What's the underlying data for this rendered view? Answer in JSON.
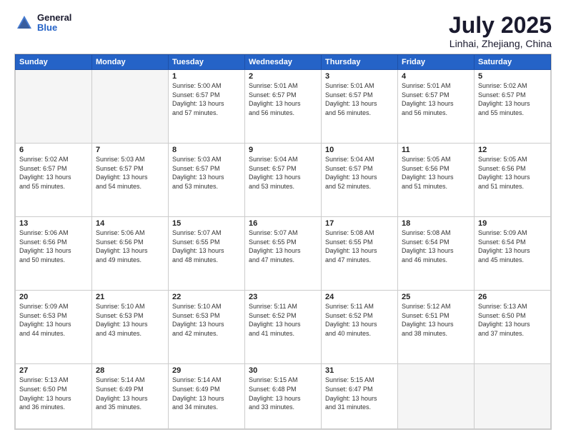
{
  "header": {
    "logo_general": "General",
    "logo_blue": "Blue",
    "title": "July 2025",
    "location": "Linhai, Zhejiang, China"
  },
  "weekdays": [
    "Sunday",
    "Monday",
    "Tuesday",
    "Wednesday",
    "Thursday",
    "Friday",
    "Saturday"
  ],
  "weeks": [
    [
      {
        "day": "",
        "empty": true
      },
      {
        "day": "",
        "empty": true
      },
      {
        "day": "1",
        "sunrise": "5:00 AM",
        "sunset": "6:57 PM",
        "daylight": "13 hours and 57 minutes."
      },
      {
        "day": "2",
        "sunrise": "5:01 AM",
        "sunset": "6:57 PM",
        "daylight": "13 hours and 56 minutes."
      },
      {
        "day": "3",
        "sunrise": "5:01 AM",
        "sunset": "6:57 PM",
        "daylight": "13 hours and 56 minutes."
      },
      {
        "day": "4",
        "sunrise": "5:01 AM",
        "sunset": "6:57 PM",
        "daylight": "13 hours and 56 minutes."
      },
      {
        "day": "5",
        "sunrise": "5:02 AM",
        "sunset": "6:57 PM",
        "daylight": "13 hours and 55 minutes."
      }
    ],
    [
      {
        "day": "6",
        "sunrise": "5:02 AM",
        "sunset": "6:57 PM",
        "daylight": "13 hours and 55 minutes."
      },
      {
        "day": "7",
        "sunrise": "5:03 AM",
        "sunset": "6:57 PM",
        "daylight": "13 hours and 54 minutes."
      },
      {
        "day": "8",
        "sunrise": "5:03 AM",
        "sunset": "6:57 PM",
        "daylight": "13 hours and 53 minutes."
      },
      {
        "day": "9",
        "sunrise": "5:04 AM",
        "sunset": "6:57 PM",
        "daylight": "13 hours and 53 minutes."
      },
      {
        "day": "10",
        "sunrise": "5:04 AM",
        "sunset": "6:57 PM",
        "daylight": "13 hours and 52 minutes."
      },
      {
        "day": "11",
        "sunrise": "5:05 AM",
        "sunset": "6:56 PM",
        "daylight": "13 hours and 51 minutes."
      },
      {
        "day": "12",
        "sunrise": "5:05 AM",
        "sunset": "6:56 PM",
        "daylight": "13 hours and 51 minutes."
      }
    ],
    [
      {
        "day": "13",
        "sunrise": "5:06 AM",
        "sunset": "6:56 PM",
        "daylight": "13 hours and 50 minutes."
      },
      {
        "day": "14",
        "sunrise": "5:06 AM",
        "sunset": "6:56 PM",
        "daylight": "13 hours and 49 minutes."
      },
      {
        "day": "15",
        "sunrise": "5:07 AM",
        "sunset": "6:55 PM",
        "daylight": "13 hours and 48 minutes."
      },
      {
        "day": "16",
        "sunrise": "5:07 AM",
        "sunset": "6:55 PM",
        "daylight": "13 hours and 47 minutes."
      },
      {
        "day": "17",
        "sunrise": "5:08 AM",
        "sunset": "6:55 PM",
        "daylight": "13 hours and 47 minutes."
      },
      {
        "day": "18",
        "sunrise": "5:08 AM",
        "sunset": "6:54 PM",
        "daylight": "13 hours and 46 minutes."
      },
      {
        "day": "19",
        "sunrise": "5:09 AM",
        "sunset": "6:54 PM",
        "daylight": "13 hours and 45 minutes."
      }
    ],
    [
      {
        "day": "20",
        "sunrise": "5:09 AM",
        "sunset": "6:53 PM",
        "daylight": "13 hours and 44 minutes."
      },
      {
        "day": "21",
        "sunrise": "5:10 AM",
        "sunset": "6:53 PM",
        "daylight": "13 hours and 43 minutes."
      },
      {
        "day": "22",
        "sunrise": "5:10 AM",
        "sunset": "6:53 PM",
        "daylight": "13 hours and 42 minutes."
      },
      {
        "day": "23",
        "sunrise": "5:11 AM",
        "sunset": "6:52 PM",
        "daylight": "13 hours and 41 minutes."
      },
      {
        "day": "24",
        "sunrise": "5:11 AM",
        "sunset": "6:52 PM",
        "daylight": "13 hours and 40 minutes."
      },
      {
        "day": "25",
        "sunrise": "5:12 AM",
        "sunset": "6:51 PM",
        "daylight": "13 hours and 38 minutes."
      },
      {
        "day": "26",
        "sunrise": "5:13 AM",
        "sunset": "6:50 PM",
        "daylight": "13 hours and 37 minutes."
      }
    ],
    [
      {
        "day": "27",
        "sunrise": "5:13 AM",
        "sunset": "6:50 PM",
        "daylight": "13 hours and 36 minutes."
      },
      {
        "day": "28",
        "sunrise": "5:14 AM",
        "sunset": "6:49 PM",
        "daylight": "13 hours and 35 minutes."
      },
      {
        "day": "29",
        "sunrise": "5:14 AM",
        "sunset": "6:49 PM",
        "daylight": "13 hours and 34 minutes."
      },
      {
        "day": "30",
        "sunrise": "5:15 AM",
        "sunset": "6:48 PM",
        "daylight": "13 hours and 33 minutes."
      },
      {
        "day": "31",
        "sunrise": "5:15 AM",
        "sunset": "6:47 PM",
        "daylight": "13 hours and 31 minutes."
      },
      {
        "day": "",
        "empty": true
      },
      {
        "day": "",
        "empty": true
      }
    ]
  ],
  "labels": {
    "sunrise_prefix": "Sunrise: ",
    "sunset_prefix": "Sunset: ",
    "daylight_prefix": "Daylight: "
  }
}
